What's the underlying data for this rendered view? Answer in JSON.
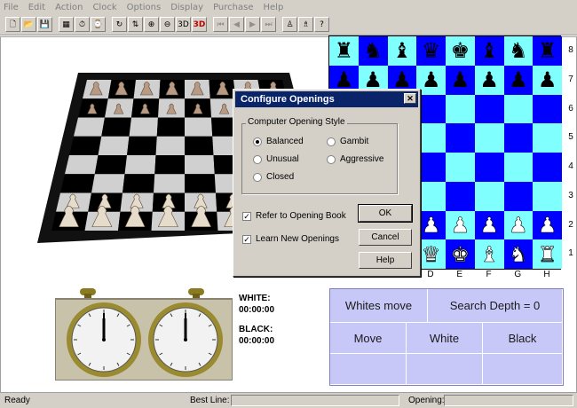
{
  "menu": [
    "File",
    "Edit",
    "Action",
    "Clock",
    "Options",
    "Display",
    "Purchase",
    "Help"
  ],
  "toolbar": [
    {
      "icon": "new-icon",
      "glyph": "🗋",
      "state": "normal"
    },
    {
      "icon": "open-icon",
      "glyph": "📂",
      "state": "normal"
    },
    {
      "icon": "save-icon",
      "glyph": "💾",
      "state": "normal"
    },
    {
      "icon": "board-icon",
      "glyph": "▦",
      "state": "normal"
    },
    {
      "icon": "clock-icon",
      "glyph": "⏱",
      "state": "normal"
    },
    {
      "icon": "clock-alt-icon",
      "glyph": "⌚",
      "state": "normal"
    },
    {
      "icon": "rotate-icon",
      "glyph": "↻",
      "state": "normal"
    },
    {
      "icon": "flip-icon",
      "glyph": "⇅",
      "state": "normal"
    },
    {
      "icon": "zoom-in-icon",
      "glyph": "⊕",
      "state": "normal"
    },
    {
      "icon": "zoom-out-icon",
      "glyph": "⊖",
      "state": "normal"
    },
    {
      "icon": "view-3d-icon",
      "glyph": "3D",
      "state": "normal"
    },
    {
      "icon": "view-3d-red-icon",
      "glyph": "3D",
      "state": "red"
    },
    {
      "icon": "first-icon",
      "glyph": "⏮",
      "state": "disabled"
    },
    {
      "icon": "prev-icon",
      "glyph": "◀",
      "state": "disabled"
    },
    {
      "icon": "next-icon",
      "glyph": "▶",
      "state": "disabled"
    },
    {
      "icon": "last-icon",
      "glyph": "⏭",
      "state": "disabled"
    },
    {
      "icon": "move-icon",
      "glyph": "♙",
      "state": "normal"
    },
    {
      "icon": "pieces-icon",
      "glyph": "♗",
      "state": "normal"
    },
    {
      "icon": "hint-icon",
      "glyph": "?",
      "state": "normal"
    }
  ],
  "board": {
    "ranks": [
      "8",
      "7",
      "6",
      "5",
      "4",
      "3",
      "2",
      "1"
    ],
    "files": [
      "D",
      "E",
      "F",
      "G",
      "H"
    ],
    "rows": [
      [
        "r",
        "n",
        "b",
        "q",
        "k",
        "b",
        "n",
        "r"
      ],
      [
        "p",
        "p",
        "p",
        "p",
        "p",
        "p",
        "p",
        "p"
      ],
      [
        "",
        "",
        "",
        "",
        "",
        "",
        "",
        ""
      ],
      [
        "",
        "",
        "",
        "",
        "",
        "",
        "",
        ""
      ],
      [
        "",
        "",
        "",
        "",
        "",
        "",
        "",
        ""
      ],
      [
        "",
        "",
        "",
        "",
        "",
        "",
        "",
        ""
      ],
      [
        "P",
        "P",
        "P",
        "P",
        "P",
        "P",
        "P",
        "P"
      ],
      [
        "R",
        "N",
        "B",
        "Q",
        "K",
        "B",
        "N",
        "R"
      ]
    ]
  },
  "dialog": {
    "title": "Configure Openings",
    "group_label": "Computer Opening Style",
    "options": {
      "balanced": "Balanced",
      "gambit": "Gambit",
      "unusual": "Unusual",
      "aggressive": "Aggressive",
      "closed": "Closed"
    },
    "selected": "balanced",
    "refer_book": "Refer to Opening Book",
    "learn_new": "Learn New Openings",
    "refer_checked": "✓",
    "learn_checked": "✓",
    "ok": "OK",
    "cancel": "Cancel",
    "help": "Help"
  },
  "clock": {
    "white_label": "WHITE:",
    "white_time": "00:00:00",
    "black_label": "BLACK:",
    "black_time": "00:00:00"
  },
  "info": {
    "turn": "Whites move",
    "depth": "Search Depth = 0",
    "col_move": "Move",
    "col_white": "White",
    "col_black": "Black"
  },
  "status": {
    "state": "Ready",
    "best_line_label": "Best Line:",
    "opening_label": "Opening:"
  }
}
